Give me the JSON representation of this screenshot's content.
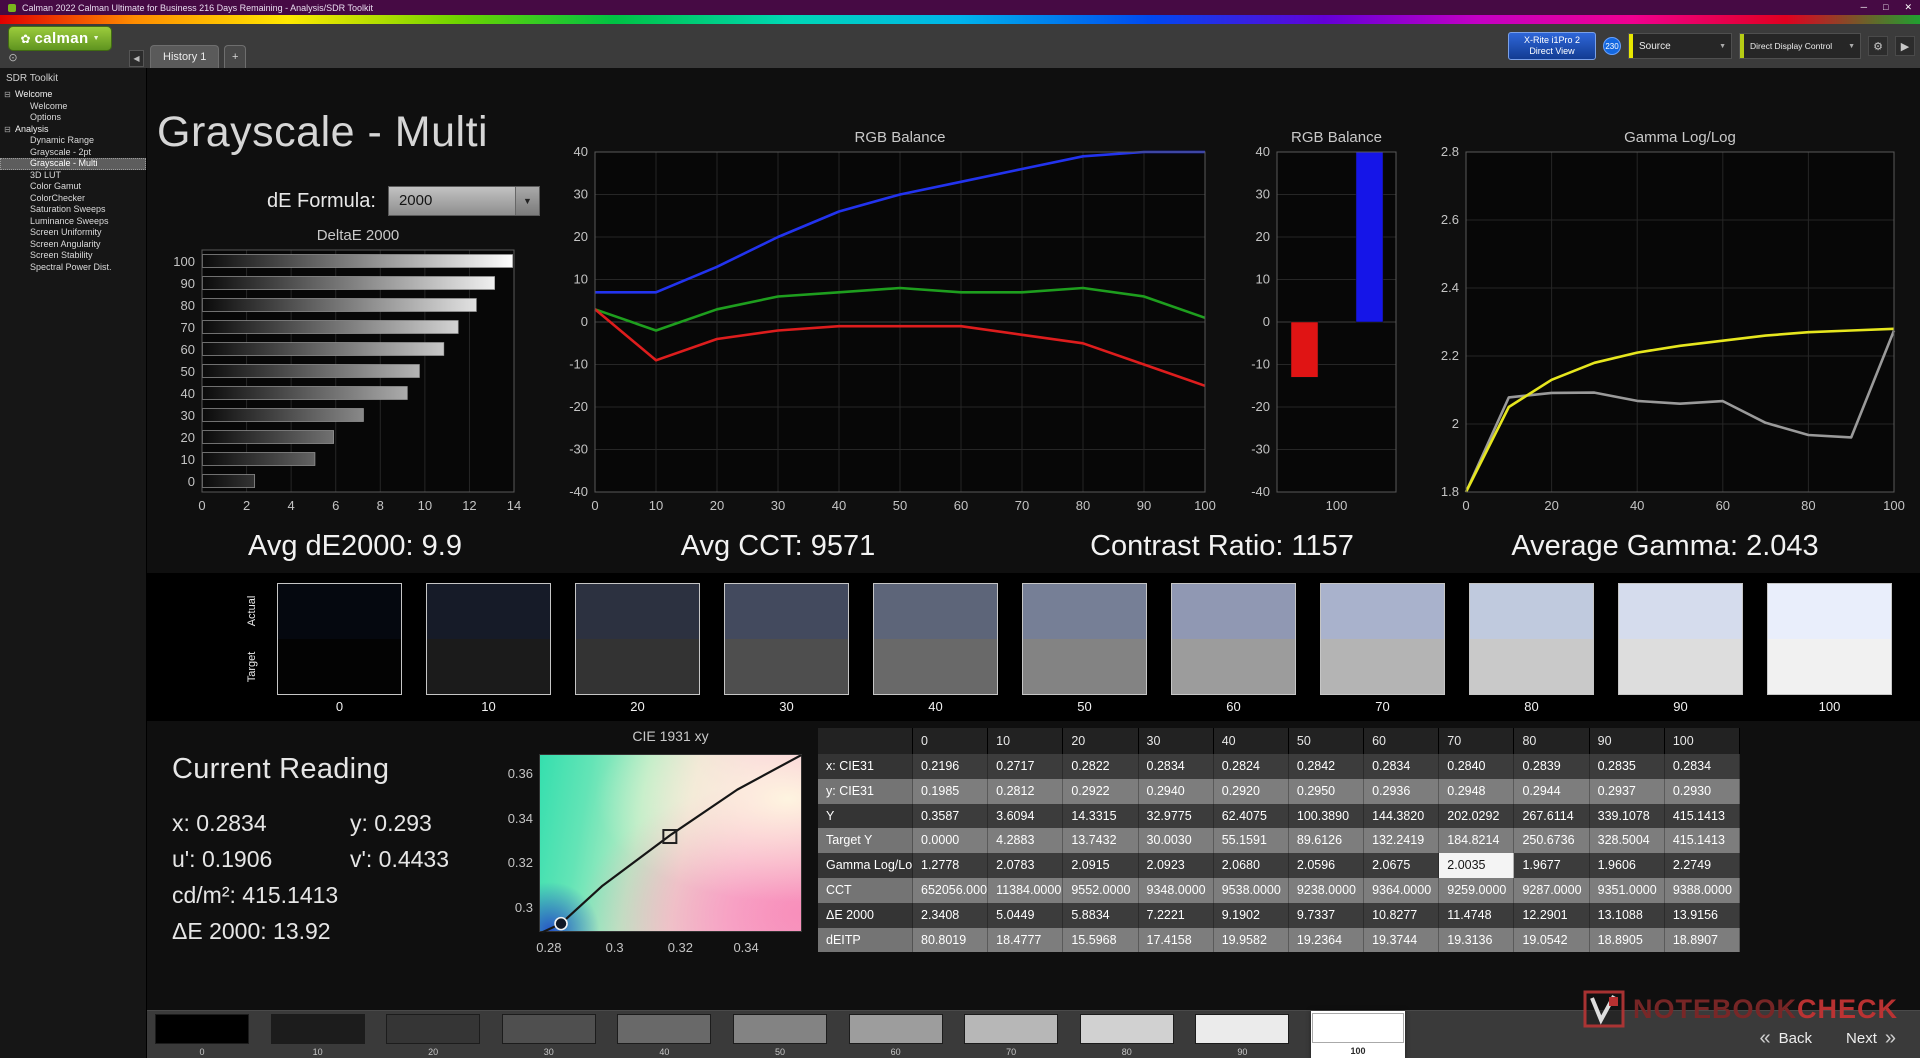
{
  "window": {
    "title": "Calman 2022 Calman Ultimate for Business 216 Days Remaining  - Analysis/SDR Toolkit"
  },
  "icons": {
    "minimize": "─",
    "maximize": "□",
    "close": "✕",
    "flower": "✿",
    "caret_down": "▼",
    "panel": "⊙",
    "collapse": "◀",
    "add_tab": "+",
    "gear": "⚙",
    "forward": "▶",
    "back_arrows": "«",
    "next_arrows": "»",
    "expander": "⊟"
  },
  "header": {
    "logo_text": "calman",
    "tabs": [
      {
        "label": "History 1"
      }
    ],
    "meter_button": {
      "line1": "X-Rite i1Pro 2",
      "line2": "Direct View"
    },
    "meter_badge": "230",
    "source_dropdown": "Source",
    "display_control_dropdown": "Direct Display Control"
  },
  "sidebar": {
    "title": "SDR Toolkit",
    "tree": [
      {
        "label": "Welcome",
        "level": 0,
        "expanded": true
      },
      {
        "label": "Welcome",
        "level": 1
      },
      {
        "label": "Options",
        "level": 1
      },
      {
        "label": "Analysis",
        "level": 0,
        "expanded": true
      },
      {
        "label": "Dynamic Range",
        "level": 1
      },
      {
        "label": "Grayscale - 2pt",
        "level": 1
      },
      {
        "label": "Grayscale - Multi",
        "level": 1,
        "selected": true
      },
      {
        "label": "3D LUT",
        "level": 1
      },
      {
        "label": "Color Gamut",
        "level": 1
      },
      {
        "label": "ColorChecker",
        "level": 1
      },
      {
        "label": "Saturation Sweeps",
        "level": 1
      },
      {
        "label": "Luminance Sweeps",
        "level": 1
      },
      {
        "label": "Screen Uniformity",
        "level": 1
      },
      {
        "label": "Screen Angularity",
        "level": 1
      },
      {
        "label": "Screen Stability",
        "level": 1
      },
      {
        "label": "Spectral Power Dist.",
        "level": 1
      }
    ]
  },
  "main": {
    "page_title": "Grayscale - Multi",
    "de_formula_label": "dE Formula:",
    "de_formula_value": "2000",
    "summaries": {
      "avg_de": "Avg dE2000: 9.9",
      "avg_cct": "Avg CCT: 9571",
      "contrast": "Contrast Ratio: 1157",
      "avg_gamma": "Average Gamma: 2.043"
    }
  },
  "current_reading": {
    "title": "Current Reading",
    "lines": [
      [
        "x: 0.2834",
        "y: 0.293"
      ],
      [
        "u': 0.1906",
        "v': 0.4433"
      ],
      [
        "cd/m²: 415.1413"
      ],
      [
        "ΔE 2000: 13.92"
      ]
    ]
  },
  "swatches": {
    "row_labels": [
      "Actual",
      "Target"
    ],
    "items": [
      {
        "label": "0",
        "actual": "#05080f",
        "target": "#030303"
      },
      {
        "label": "10",
        "actual": "#161b28",
        "target": "#1b1b1b"
      },
      {
        "label": "20",
        "actual": "#2c3140",
        "target": "#333333"
      },
      {
        "label": "30",
        "actual": "#434a5e",
        "target": "#4e4e4e"
      },
      {
        "label": "40",
        "actual": "#5d6579",
        "target": "#696969"
      },
      {
        "label": "50",
        "actual": "#767f96",
        "target": "#838383"
      },
      {
        "label": "60",
        "actual": "#9098b3",
        "target": "#9c9c9c"
      },
      {
        "label": "70",
        "actual": "#a9b2cc",
        "target": "#b4b4b4"
      },
      {
        "label": "80",
        "actual": "#c0cade",
        "target": "#c9c9c9"
      },
      {
        "label": "90",
        "actual": "#d5dced",
        "target": "#dddddd"
      },
      {
        "label": "100",
        "actual": "#e9eefb",
        "target": "#f1f1f1"
      }
    ]
  },
  "bottom_bar": {
    "back_label": "Back",
    "next_label": "Next",
    "patches": [
      {
        "label": "0",
        "color": "#000000"
      },
      {
        "label": "10",
        "color": "#1c1c1c"
      },
      {
        "label": "20",
        "color": "#353535"
      },
      {
        "label": "30",
        "color": "#4f4f4f"
      },
      {
        "label": "40",
        "color": "#696969"
      },
      {
        "label": "50",
        "color": "#838383"
      },
      {
        "label": "60",
        "color": "#9d9d9d"
      },
      {
        "label": "70",
        "color": "#b7b7b7"
      },
      {
        "label": "80",
        "color": "#d1d1d1"
      },
      {
        "label": "90",
        "color": "#ebebeb"
      },
      {
        "label": "100",
        "color": "#ffffff",
        "selected": true
      }
    ]
  },
  "watermark": {
    "text1": "NOTEBOOK",
    "text2": "CHECK"
  },
  "chart_data": [
    {
      "id": "deltae",
      "type": "bar",
      "orientation": "horizontal",
      "title": "DeltaE 2000",
      "categories": [
        100,
        90,
        80,
        70,
        60,
        50,
        40,
        30,
        20,
        10,
        0
      ],
      "values": [
        13.9156,
        13.1088,
        12.2901,
        11.4748,
        10.8277,
        9.7337,
        9.1902,
        7.2221,
        5.8834,
        5.0449,
        2.3408
      ],
      "xlim": [
        0,
        14
      ],
      "xticks": [
        0,
        2,
        4,
        6,
        8,
        10,
        12,
        14
      ],
      "bar_fill": "grayscale-gradient"
    },
    {
      "id": "rgb-balance-line",
      "type": "line",
      "title": "RGB Balance",
      "x": [
        0,
        10,
        20,
        30,
        40,
        50,
        60,
        70,
        80,
        90,
        100
      ],
      "series": [
        {
          "name": "Blue",
          "color": "#2233ee",
          "values": [
            7,
            7,
            13,
            20,
            26,
            30,
            33,
            36,
            39,
            40,
            40
          ]
        },
        {
          "name": "Green",
          "color": "#1e9e1e",
          "values": [
            3,
            -2,
            3,
            6,
            7,
            8,
            7,
            7,
            8,
            6,
            1
          ]
        },
        {
          "name": "Red",
          "color": "#dd1d1d",
          "values": [
            3,
            -9,
            -4,
            -2,
            -1,
            -1,
            -1,
            -3,
            -5,
            -10,
            -15
          ]
        }
      ],
      "ylim": [
        -40,
        40
      ],
      "yticks": [
        40,
        30,
        20,
        10,
        0,
        -10,
        -20,
        -30,
        -40
      ],
      "xticks": [
        0,
        10,
        20,
        30,
        40,
        50,
        60,
        70,
        80,
        90,
        100
      ]
    },
    {
      "id": "rgb-balance-bar",
      "type": "bar",
      "title": "RGB Balance",
      "categories": [
        "100"
      ],
      "series": [
        {
          "name": "Red",
          "color": "#e01414",
          "values": [
            -13
          ]
        },
        {
          "name": "Green",
          "color": "#00a000",
          "values": [
            0
          ]
        },
        {
          "name": "Blue",
          "color": "#1515e8",
          "values": [
            40
          ]
        }
      ],
      "ylim": [
        -40,
        40
      ],
      "yticks": [
        40,
        30,
        20,
        10,
        0,
        -10,
        -20,
        -30,
        -40
      ]
    },
    {
      "id": "gamma",
      "type": "line",
      "title": "Gamma Log/Log",
      "x": [
        0,
        10,
        20,
        30,
        40,
        50,
        60,
        70,
        80,
        90,
        100
      ],
      "series": [
        {
          "name": "Measured gamma",
          "color": "#9a9a9a",
          "values": [
            1.2778,
            2.0783,
            2.0915,
            2.0923,
            2.068,
            2.0596,
            2.0675,
            2.0035,
            1.9677,
            1.9606,
            2.2749
          ]
        },
        {
          "name": "Cumulative gamma",
          "color": "#e6e61e",
          "values": [
            1.78,
            2.05,
            2.13,
            2.18,
            2.21,
            2.23,
            2.245,
            2.26,
            2.27,
            2.275,
            2.28
          ]
        }
      ],
      "ylim": [
        1.8,
        2.8
      ],
      "yticks": [
        "2.8",
        "2.6",
        "2.4",
        "2.2",
        "2",
        "1.8"
      ],
      "xticks": [
        0,
        20,
        40,
        60,
        80,
        100
      ]
    },
    {
      "id": "cie",
      "type": "scatter",
      "title": "CIE 1931 xy",
      "xlim": [
        0.277,
        0.357
      ],
      "ylim": [
        0.2888,
        0.3685
      ],
      "xticks": [
        0.28,
        0.3,
        0.32,
        0.34
      ],
      "yticks": [
        0.36,
        0.34,
        0.32,
        0.3
      ],
      "locus": [
        [
          0.2775,
          0.289
        ],
        [
          0.2834,
          0.293
        ],
        [
          0.296,
          0.31
        ],
        [
          0.317,
          0.333
        ],
        [
          0.337,
          0.353
        ],
        [
          0.3565,
          0.3685
        ]
      ],
      "markers": [
        {
          "shape": "square",
          "x": 0.3165,
          "y": 0.332,
          "label": "target white point"
        },
        {
          "shape": "circle",
          "x": 0.2834,
          "y": 0.293,
          "label": "measured point"
        }
      ]
    },
    {
      "id": "data-table",
      "type": "table",
      "columns": [
        "",
        "0",
        "10",
        "20",
        "30",
        "40",
        "50",
        "60",
        "70",
        "80",
        "90",
        "100"
      ],
      "rows": [
        {
          "label": "x: CIE31",
          "values": [
            "0.2196",
            "0.2717",
            "0.2822",
            "0.2834",
            "0.2824",
            "0.2842",
            "0.2834",
            "0.2840",
            "0.2839",
            "0.2835",
            "0.2834"
          ]
        },
        {
          "label": "y: CIE31",
          "values": [
            "0.1985",
            "0.2812",
            "0.2922",
            "0.2940",
            "0.2920",
            "0.2950",
            "0.2936",
            "0.2948",
            "0.2944",
            "0.2937",
            "0.2930"
          ]
        },
        {
          "label": "Y",
          "values": [
            "0.3587",
            "3.6094",
            "14.3315",
            "32.9775",
            "62.4075",
            "100.3890",
            "144.3820",
            "202.0292",
            "267.6114",
            "339.1078",
            "415.1413"
          ]
        },
        {
          "label": "Target Y",
          "values": [
            "0.0000",
            "4.2883",
            "13.7432",
            "30.0030",
            "55.1591",
            "89.6126",
            "132.2419",
            "184.8214",
            "250.6736",
            "328.5004",
            "415.1413"
          ]
        },
        {
          "label": "Gamma Log/Log",
          "values": [
            "1.2778",
            "2.0783",
            "2.0915",
            "2.0923",
            "2.0680",
            "2.0596",
            "2.0675",
            "2.0035",
            "1.9677",
            "1.9606",
            "2.2749"
          ],
          "highlight_col": 7
        },
        {
          "label": "CCT",
          "values": [
            "652056.0000",
            "11384.0000",
            "9552.0000",
            "9348.0000",
            "9538.0000",
            "9238.0000",
            "9364.0000",
            "9259.0000",
            "9287.0000",
            "9351.0000",
            "9388.0000"
          ]
        },
        {
          "label": "ΔE 2000",
          "values": [
            "2.3408",
            "5.0449",
            "5.8834",
            "7.2221",
            "9.1902",
            "9.7337",
            "10.8277",
            "11.4748",
            "12.2901",
            "13.1088",
            "13.9156"
          ]
        },
        {
          "label": "dEITP",
          "values": [
            "80.8019",
            "18.4777",
            "15.5968",
            "17.4158",
            "19.9582",
            "19.2364",
            "19.3744",
            "19.3136",
            "19.0542",
            "18.8905",
            "18.8907"
          ]
        }
      ]
    }
  ]
}
